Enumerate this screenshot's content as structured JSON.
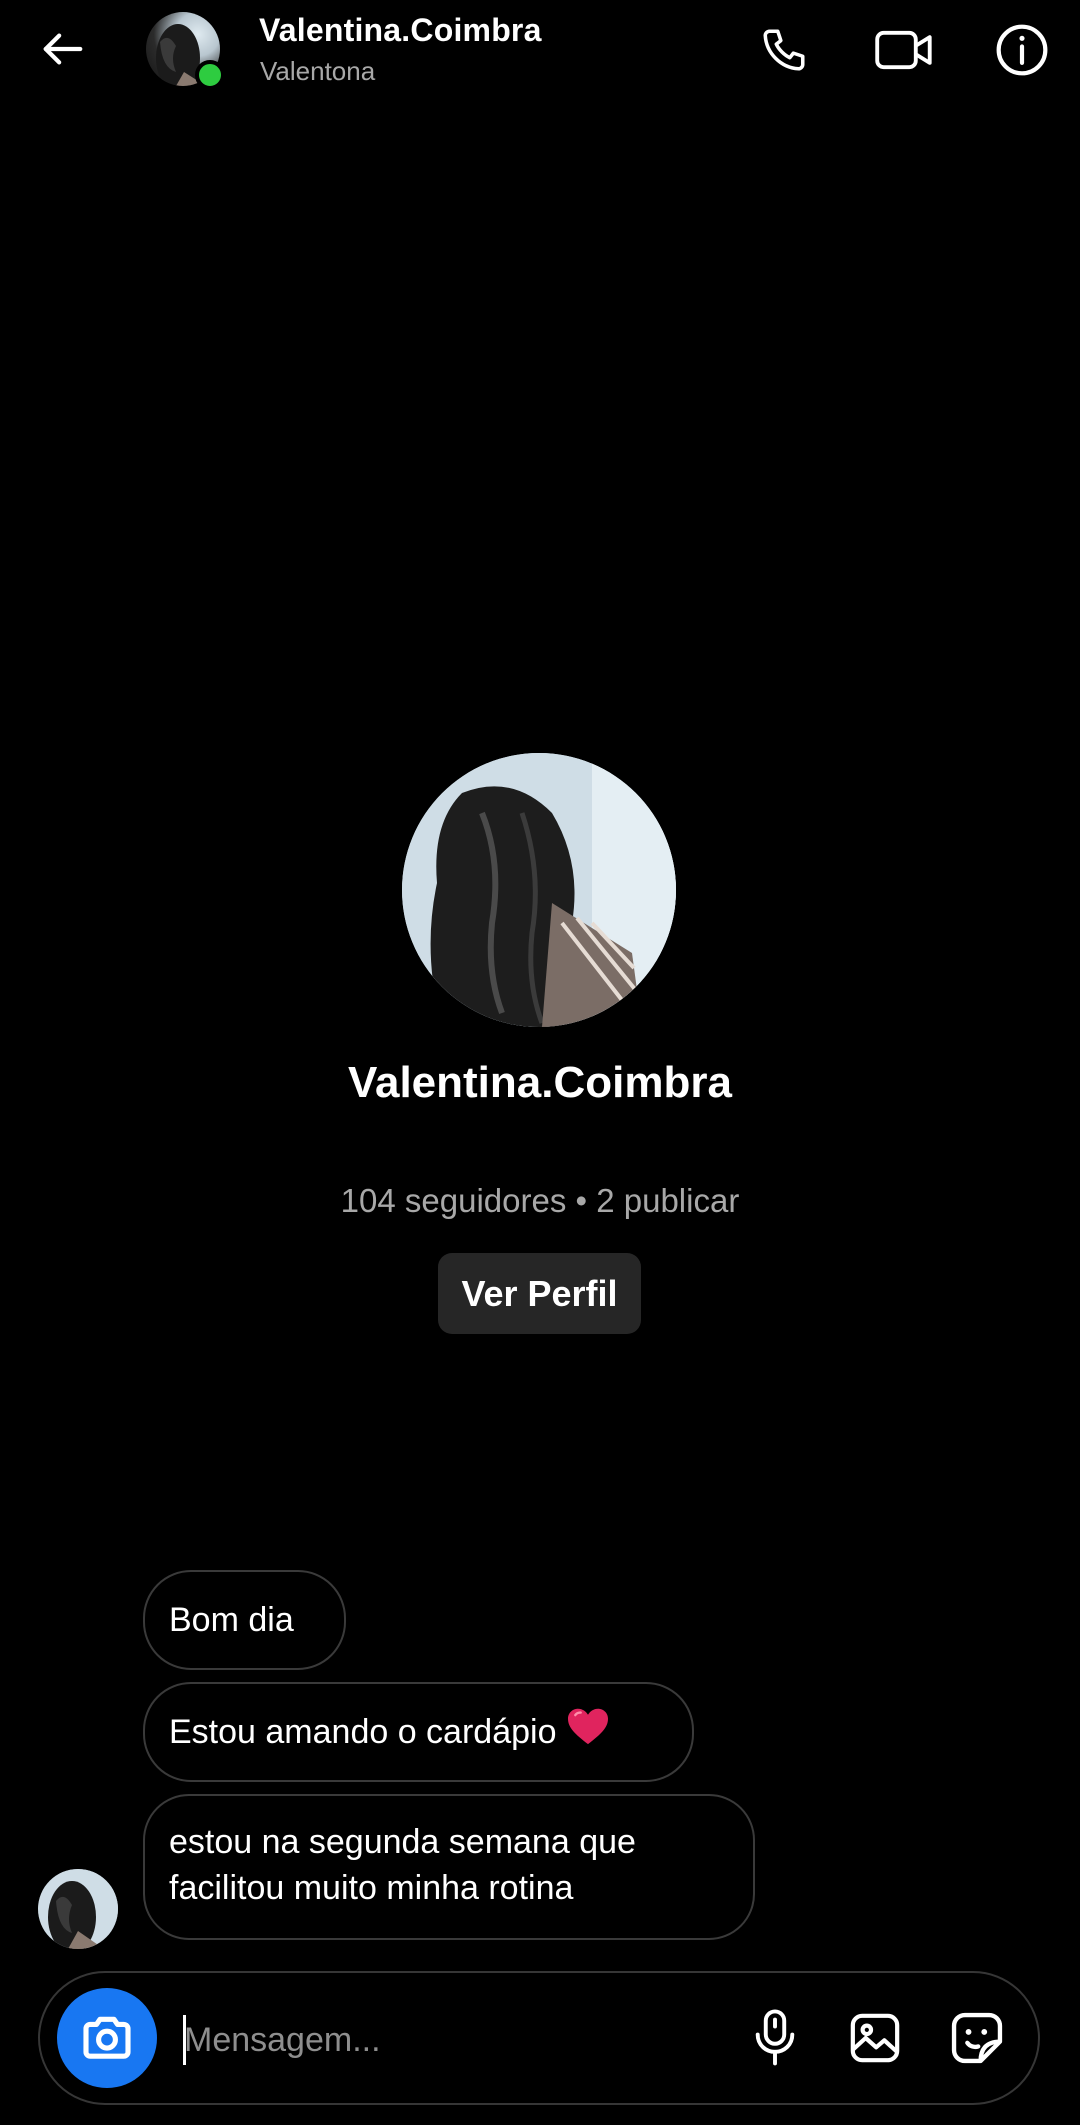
{
  "header": {
    "name": "Valentina.Coimbra",
    "subtitle": "Valentona",
    "icons": [
      "back-arrow-icon",
      "phone-icon",
      "video-camera-icon",
      "info-icon"
    ]
  },
  "profile": {
    "name": "Valentina.Coimbra",
    "stats": "104 seguidores • 2 publicar",
    "view_profile_label": "Ver Perfil"
  },
  "messages": [
    {
      "text": "Bom dia"
    },
    {
      "text": "Estou amando o cardápio"
    },
    {
      "text": "estou na segunda semana que facilitou muito minha rotina"
    }
  ],
  "composer": {
    "placeholder": "Mensagem...",
    "icons": [
      "camera-icon",
      "microphone-icon",
      "gallery-icon",
      "sticker-icon"
    ]
  },
  "colors": {
    "background": "#000000",
    "accent": "#1877f2",
    "online": "#2ecc40",
    "bubble_border": "#3a3a3a",
    "muted_text": "#a8a8a8"
  }
}
